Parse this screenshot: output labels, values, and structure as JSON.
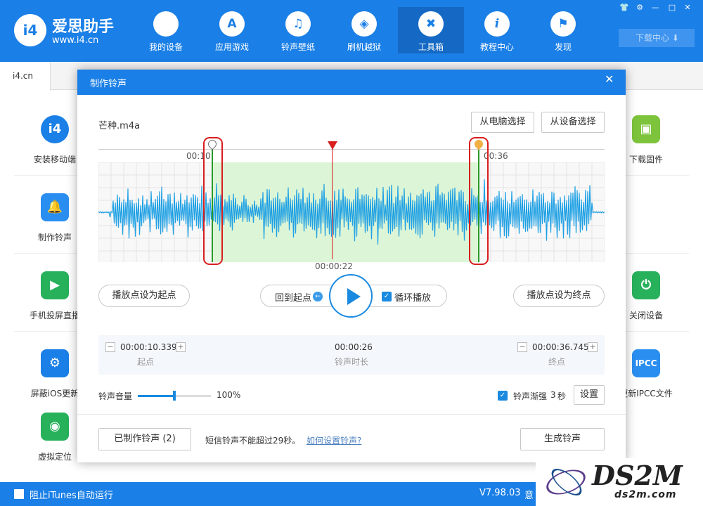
{
  "app": {
    "name": "爱思助手",
    "url": "www.i4.cn",
    "logo_text": "i4"
  },
  "nav": [
    {
      "label": "我的设备",
      "icon": "apple-icon",
      "glyph": "",
      "active": false
    },
    {
      "label": "应用游戏",
      "icon": "app-store-icon",
      "glyph": "A",
      "active": false
    },
    {
      "label": "铃声壁纸",
      "icon": "music-icon",
      "glyph": "♫",
      "active": false
    },
    {
      "label": "刷机越狱",
      "icon": "dropbox-icon",
      "glyph": "◈",
      "active": false
    },
    {
      "label": "工具箱",
      "icon": "tools-icon",
      "glyph": "✖",
      "active": true
    },
    {
      "label": "教程中心",
      "icon": "info-icon",
      "glyph": "i",
      "active": false
    },
    {
      "label": "发现",
      "icon": "flag-icon",
      "glyph": "⚑",
      "active": false
    }
  ],
  "window_controls": [
    "👕",
    "⚙",
    "—",
    "□",
    "✕"
  ],
  "download_center": "下载中心",
  "tab": "i4.cn",
  "sidebar_left": [
    {
      "label": "安装移动端",
      "glyph": "i4",
      "color": "#1a7fe6"
    },
    {
      "label": "制作铃声",
      "glyph": "🔔",
      "color": "#2a8ef0"
    },
    {
      "label": "手机投屏直播",
      "glyph": "▶",
      "color": "#27b15b"
    },
    {
      "label": "屏蔽iOS更新",
      "glyph": "⚙",
      "color": "#1a7fe6"
    },
    {
      "label": "虚拟定位",
      "glyph": "◉",
      "color": "#27b15b"
    }
  ],
  "sidebar_right": [
    {
      "label": "下载固件",
      "glyph": "▣",
      "color": "#7dc43c"
    },
    {
      "label": "关闭设备",
      "glyph": "⏻",
      "color": "#27b15b"
    },
    {
      "label": "更新IPCC文件",
      "glyph": "IPCC",
      "color": "#2a8ef0"
    }
  ],
  "statusbar": {
    "block_itunes": "阻止iTunes自动运行",
    "version": "V7.98.03",
    "extra": "意"
  },
  "watermark": {
    "big": "DS2M",
    "small": "ds2m.com"
  },
  "modal": {
    "title": "制作铃声",
    "close": "✕",
    "file_name": "芒种.m4a",
    "from_pc": "从电脑选择",
    "from_device": "从设备选择",
    "marker_start_label": "00:10",
    "marker_end_label": "00:36",
    "playhead_time": "00:00:22",
    "set_start": "播放点设为起点",
    "back_to_start": "回到起点",
    "loop_play": "循环播放",
    "set_end": "播放点设为终点",
    "start_value": "00:00:10.339",
    "start_label": "起点",
    "duration_value": "00:00:26",
    "duration_label": "铃声时长",
    "end_value": "00:00:36.745",
    "end_label": "终点",
    "volume_label": "铃声音量",
    "volume_value": "100%",
    "volume_level": 0.5,
    "fade_label": "铃声渐强",
    "fade_value": "3",
    "fade_unit": "秒",
    "fade_settings": "设置",
    "made_count": "已制作铃声 (2)",
    "sms_notice": "短信铃声不能超过29秒。",
    "howto_link": "如何设置铃声?",
    "generate": "生成铃声"
  },
  "colors": {
    "brand": "#1a7fe6",
    "selection": "#dcf5d6",
    "wave": "#1ea0e4",
    "highlight": "#d81e1e",
    "marker": "#2a9a2a"
  }
}
